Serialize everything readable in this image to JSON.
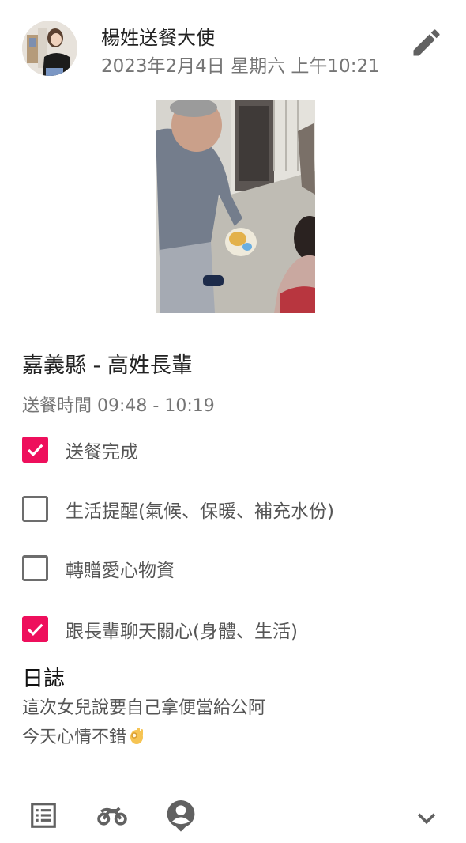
{
  "post": {
    "author": "楊姓送餐大使",
    "timestamp": "2023年2月4日 星期六 上午10:21",
    "location": "嘉義縣 - 高姓長輩",
    "delivery_time": "送餐時間 09:48 - 10:19"
  },
  "checklist": [
    {
      "label": "送餐完成",
      "checked": true
    },
    {
      "label": "生活提醒(氣候、保暖、補充水份)",
      "checked": false
    },
    {
      "label": "轉贈愛心物資",
      "checked": false
    },
    {
      "label": "跟長輩聊天關心(身體、生活)",
      "checked": true
    }
  ],
  "log": {
    "title": "日誌",
    "lines": [
      "這次女兒說要自己拿便當給公阿",
      "今天心情不錯"
    ]
  },
  "icons": {
    "edit": "pencil-icon",
    "list": "list-icon",
    "transport": "motorcycle-icon",
    "person": "account-pin-icon",
    "expand": "chevron-down-icon"
  },
  "colors": {
    "accent": "#ee0f5c",
    "icon_gray": "#616161"
  }
}
